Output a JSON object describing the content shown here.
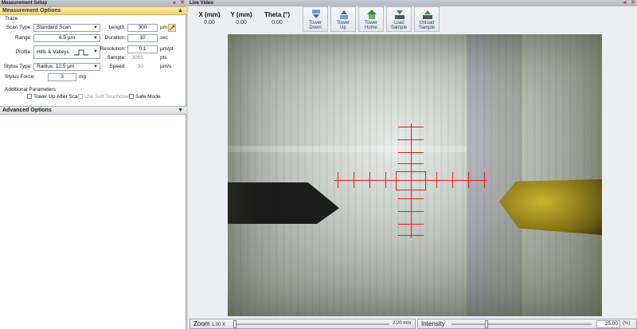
{
  "left_panel": {
    "title": "Measurement Setup",
    "measurement_options": "Measurement Options",
    "trace": "Trace",
    "scan_type": {
      "label": "Scan Type:",
      "value": "Standard Scan"
    },
    "range": {
      "label": "Range:",
      "value": "6.5 µm"
    },
    "profile": {
      "label": "Profile:",
      "value": "Hills & Valleys"
    },
    "stylus_type": {
      "label": "Stylus Type:",
      "value": "Radius: 12.5 µm"
    },
    "stylus_force": {
      "label": "Stylus Force:",
      "value": "3",
      "unit": "mg"
    },
    "length": {
      "label": "Length:",
      "value": "300",
      "unit": "µm"
    },
    "duration": {
      "label": "Duration:",
      "value": "10",
      "unit": "sec"
    },
    "resolution": {
      "label": "Resolution:",
      "value": "0.1",
      "unit": "µm/pt"
    },
    "sample": {
      "label": "Sample:",
      "value": "3001",
      "unit": "pts"
    },
    "speed": {
      "label": "Speed:",
      "value": "30",
      "unit": "µm/s"
    },
    "additional": "Additional Parameters",
    "checks": {
      "tower_up": "Tower Up After Scan",
      "soft_touchdown": "Use Soft Touchdown",
      "safe_mode": "Safe Mode"
    },
    "advanced_options": "Advanced Options"
  },
  "right_panel": {
    "title": "Live Video",
    "coords": [
      {
        "label": "X (mm)",
        "value": "0.00"
      },
      {
        "label": "Y (mm)",
        "value": "0.00"
      },
      {
        "label": "Theta (°)",
        "value": "0.00"
      }
    ],
    "buttons": [
      {
        "line1": "Tower",
        "line2": "Down",
        "icon": "tower-down-icon"
      },
      {
        "line1": "Tower",
        "line2": "Up",
        "icon": "tower-up-icon"
      },
      {
        "line1": "Tower",
        "line2": "Home",
        "icon": "tower-home-icon"
      },
      {
        "line1": "Load",
        "line2": "Sample",
        "icon": "load-sample-icon"
      },
      {
        "line1": "Unload",
        "line2": "Sample",
        "icon": "unload-sample-icon"
      }
    ],
    "zoom": {
      "label": "Zoom",
      "min": "1.00 X",
      "max": "2.20 mm"
    },
    "intensity": {
      "label": "Intensity",
      "value": "25.00",
      "unit": "(%)",
      "level_percent": 25
    }
  },
  "colors": {
    "section_header": "#f7d27a",
    "crosshair": "#e0202a",
    "probe_tip": "#c9b430"
  }
}
